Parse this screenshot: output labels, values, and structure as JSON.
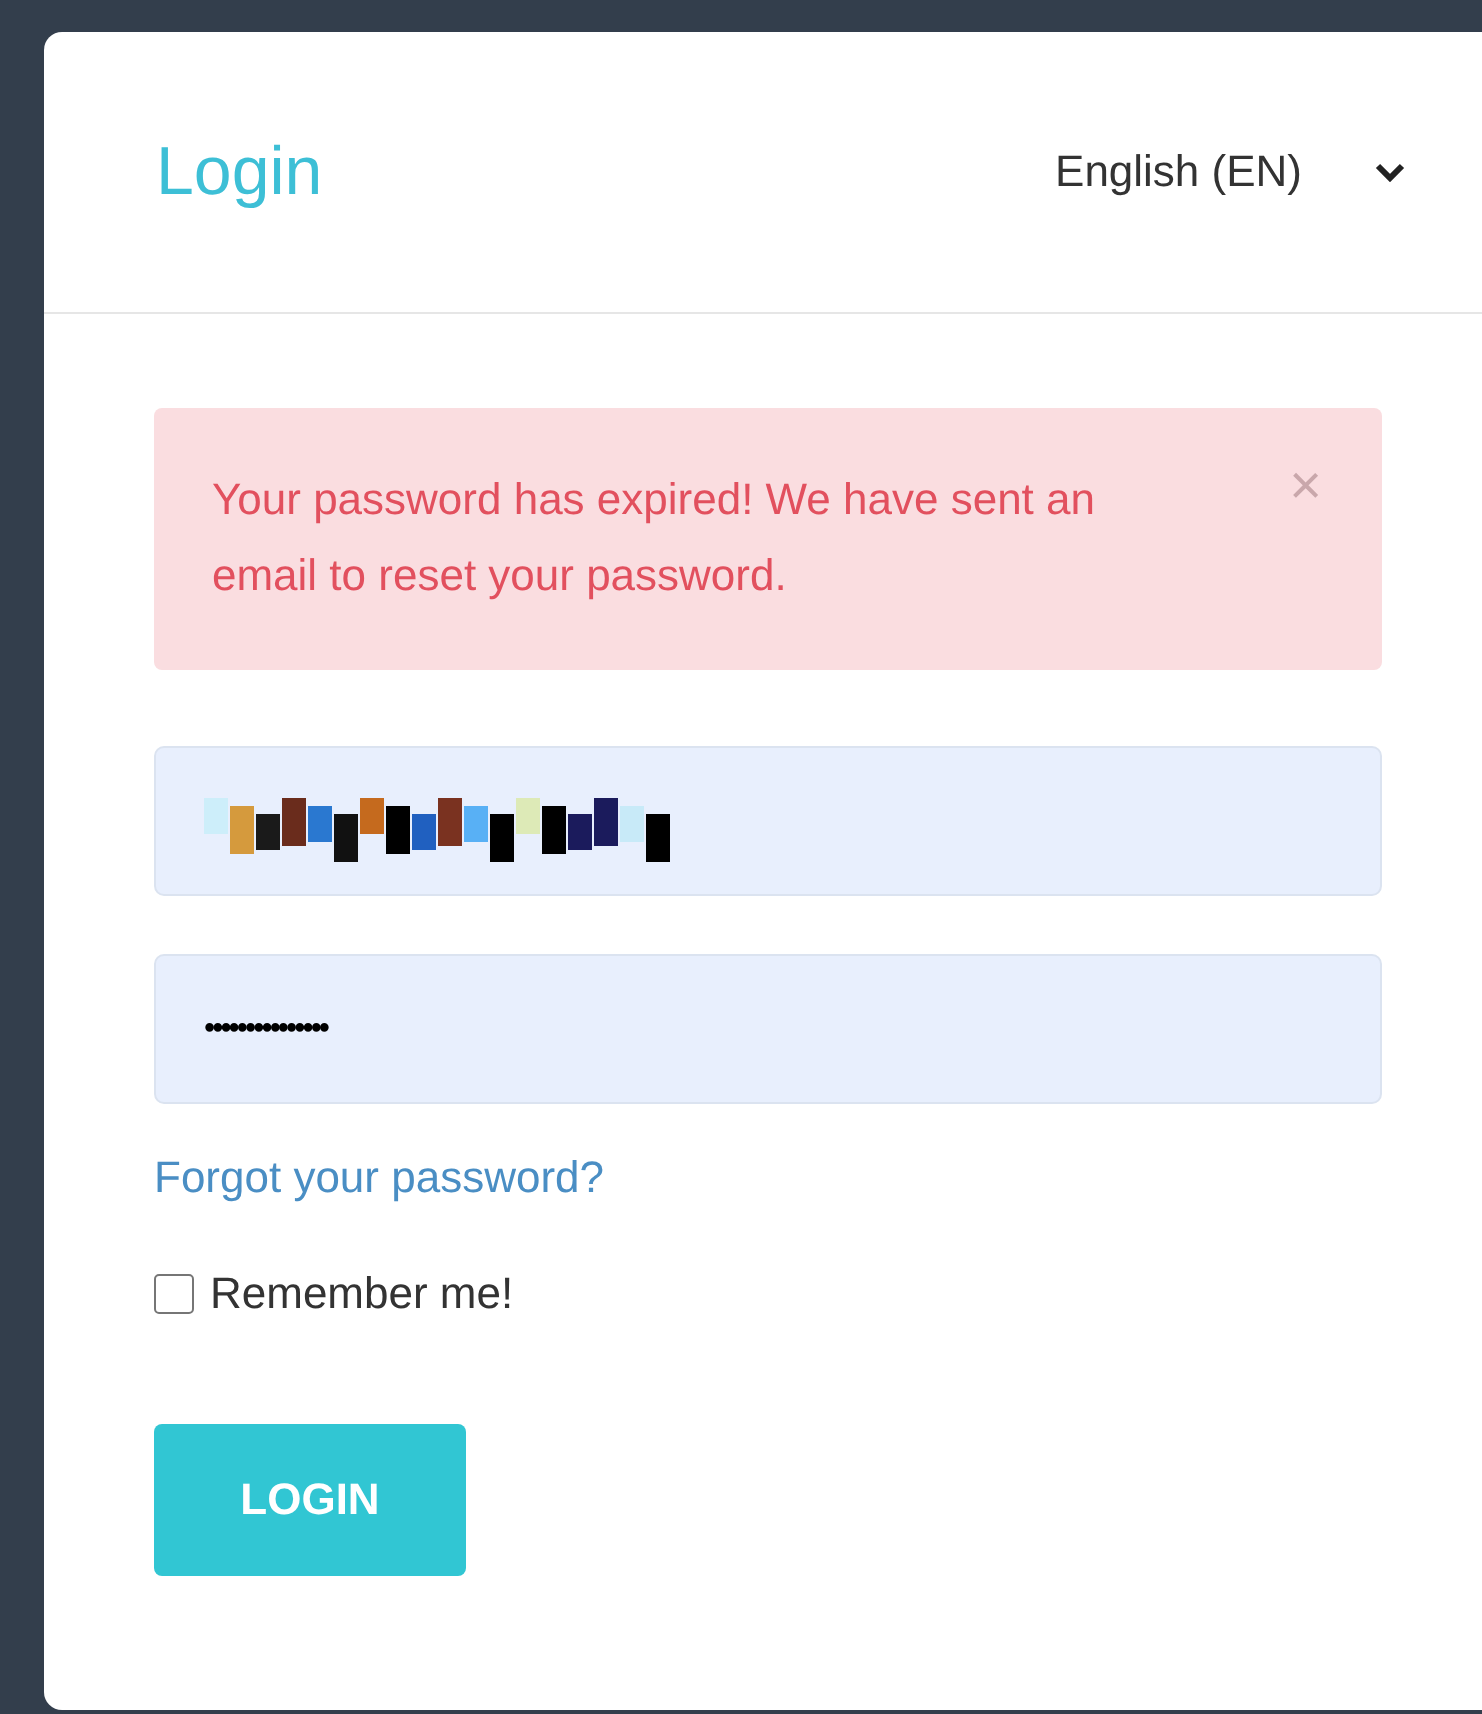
{
  "header": {
    "title": "Login",
    "language": "English (EN)"
  },
  "alert": {
    "message": "Your password has expired! We have sent an email to reset your password.",
    "close": "×"
  },
  "fields": [
    {
      "kind": "obscured"
    },
    {
      "kind": "password",
      "value": "•••••••••••••••"
    }
  ],
  "forgot_link": "Forgot your password?",
  "remember": {
    "label": "Remember me!",
    "checked": false
  },
  "login_button": "LOGIN"
}
